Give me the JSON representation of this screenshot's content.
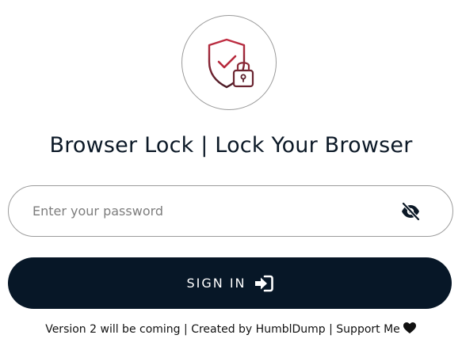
{
  "title": "Browser Lock | Lock Your Browser",
  "password": {
    "value": "",
    "placeholder": "Enter your password"
  },
  "signin": {
    "label": "SIGN IN"
  },
  "footer": {
    "version_text": "Version 2 will be coming",
    "separator1": " | ",
    "created_prefix": "Created by ",
    "author": "HumblDump",
    "separator2": " | ",
    "support": "Support Me"
  },
  "icons": {
    "logo": "shield-check-lock-icon",
    "eye": "eye-slash-icon",
    "signin": "sign-in-icon",
    "heart": "heart-icon"
  },
  "colors": {
    "logo_red": "#b7283b",
    "logo_dark": "#3a1a22",
    "navy": "#071727",
    "text": "#0b1826",
    "placeholder": "#7d7d7d",
    "border": "#9c9c9c"
  }
}
